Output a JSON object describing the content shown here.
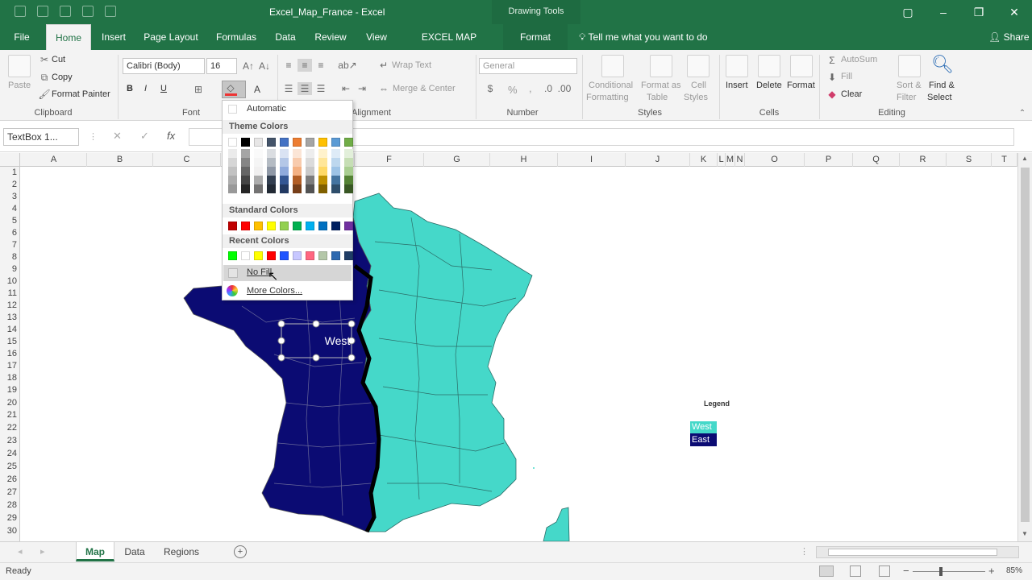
{
  "app": {
    "title": "Excel_Map_France  -  Excel",
    "contextual_group": "Drawing Tools",
    "window_buttons": [
      "▢",
      "–",
      "❐",
      "✕"
    ]
  },
  "tabs": [
    {
      "label": "File"
    },
    {
      "label": "Home"
    },
    {
      "label": "Insert"
    },
    {
      "label": "Page Layout"
    },
    {
      "label": "Formulas"
    },
    {
      "label": "Data"
    },
    {
      "label": "Review"
    },
    {
      "label": "View"
    },
    {
      "label": "EXCEL MAP FRANCE"
    },
    {
      "label": "Format"
    }
  ],
  "tell_me": "Tell me what you want to do",
  "share": "Share",
  "clipboard": {
    "paste": "Paste",
    "cut": "Cut",
    "copy": "Copy",
    "format_painter": "Format Painter",
    "group": "Clipboard"
  },
  "font": {
    "name": "Calibri (Body)",
    "size": "16",
    "bold": "B",
    "italic": "I",
    "underline": "U",
    "group": "Font"
  },
  "alignment": {
    "wrap_text": "Wrap Text",
    "merge_center": "Merge & Center",
    "group": "Alignment"
  },
  "number": {
    "format": "General",
    "percent": "%",
    "comma": ",",
    "group": "Number"
  },
  "styles": {
    "conditional": "Conditional",
    "conditional2": "Formatting",
    "format_as": "Format as",
    "format_as2": "Table",
    "cell": "Cell",
    "cell2": "Styles",
    "group": "Styles"
  },
  "cells": {
    "insert": "Insert",
    "delete": "Delete",
    "format": "Format",
    "group": "Cells"
  },
  "editing": {
    "autosum": "AutoSum",
    "fill": "Fill",
    "clear": "Clear",
    "sort": "Sort &",
    "sort2": "Filter",
    "find": "Find &",
    "find2": "Select",
    "group": "Editing"
  },
  "formula_bar": {
    "name_box": "TextBox 1...",
    "fx": "fx",
    "cancel": "✕",
    "enter": "✓"
  },
  "columns": [
    "A",
    "B",
    "C",
    "D",
    "E",
    "F",
    "G",
    "H",
    "I",
    "J",
    "K",
    "L",
    "M",
    "N",
    "O",
    "P",
    "Q",
    "R",
    "S",
    "T"
  ],
  "rows": [
    "1",
    "2",
    "3",
    "4",
    "5",
    "6",
    "7",
    "8",
    "9",
    "10",
    "11",
    "12",
    "13",
    "14",
    "15",
    "16",
    "17",
    "18",
    "19",
    "20",
    "21",
    "22",
    "23",
    "24",
    "25",
    "26",
    "27",
    "28",
    "29",
    "30"
  ],
  "color_menu": {
    "automatic": "Automatic",
    "theme_header": "Theme Colors",
    "standard_header": "Standard Colors",
    "recent_header": "Recent Colors",
    "no_fill": "No Fill",
    "more_colors": "More Colors...",
    "theme_top": [
      "#ffffff",
      "#000000",
      "#e7e6e6",
      "#44546a",
      "#4472c4",
      "#ed7d31",
      "#a5a5a5",
      "#ffc000",
      "#5b9bd5",
      "#70ad47"
    ],
    "standard": [
      "#c00000",
      "#ff0000",
      "#ffc000",
      "#ffff00",
      "#92d050",
      "#00b050",
      "#00b0f0",
      "#0070c0",
      "#002060",
      "#7030a0"
    ],
    "recent": [
      "#00ff00",
      "#ffffff",
      "#ffff00",
      "#ff0000",
      "#1f55ff",
      "#c7c7ff",
      "#ff6680",
      "#b4c7a8",
      "#2e6ab0",
      "#1f3d66"
    ]
  },
  "map": {
    "textbox_label": "West",
    "legend_title": "Legend",
    "legend_west": "West",
    "legend_east": "East",
    "west_color": "#0b0b73",
    "east_color": "#45d8c9"
  },
  "sheets": [
    {
      "label": "Map"
    },
    {
      "label": "Data"
    },
    {
      "label": "Regions"
    }
  ],
  "status": {
    "ready": "Ready",
    "zoom": "85%"
  },
  "colors": {
    "accent": "#217346"
  }
}
